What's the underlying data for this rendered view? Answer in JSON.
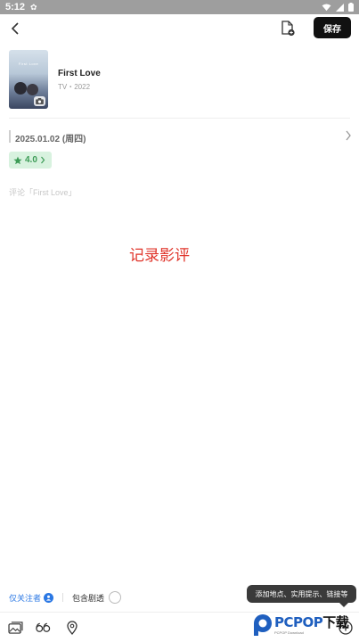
{
  "status_bar": {
    "time": "5:12"
  },
  "header": {
    "save_label": "保存"
  },
  "movie": {
    "poster_title": "First Love",
    "title": "First Love",
    "meta": "TV・2022"
  },
  "watch": {
    "date": "2025.01.02 (周四)"
  },
  "rating": {
    "value": "4.0",
    "star_color": "#3c9b56",
    "badge_bg": "#d8f2df"
  },
  "comment": {
    "placeholder": "评论「First Love」",
    "value": ""
  },
  "overlay_caption": "记录影评",
  "visibility": {
    "followers_only_label": "仅关注者",
    "spoiler_label": "包含剧透",
    "spoiler_checked": false
  },
  "tooltip": {
    "text": "添加地点、实用提示、链接等"
  },
  "toolbar": {
    "icons": [
      "image-icon",
      "quote-icon",
      "location-icon",
      "add-icon"
    ]
  },
  "watermark": {
    "main": "PCPOP",
    "suffix": "下载",
    "sub": "PCPOP Download"
  },
  "colors": {
    "accent_blue": "#2b78e4",
    "save_bg": "#111111",
    "caption_red": "#e0352b"
  }
}
